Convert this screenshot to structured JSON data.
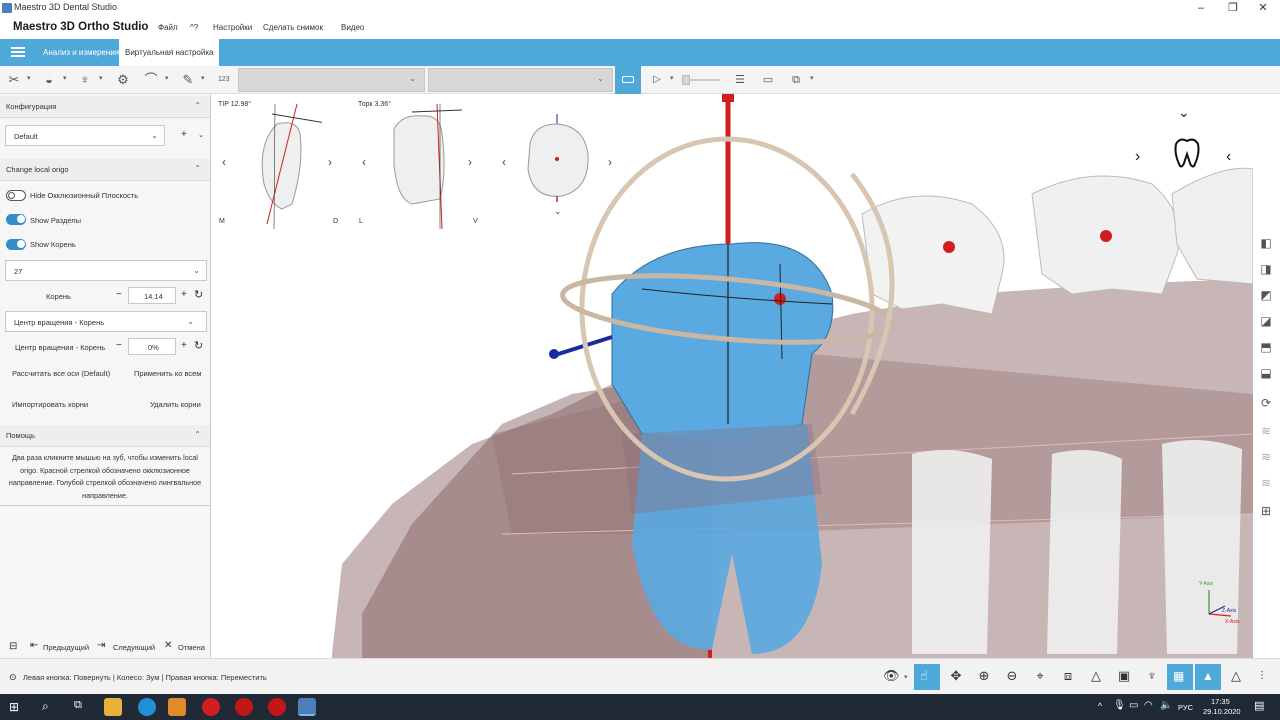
{
  "window": {
    "title": "Maestro 3D Dental Studio",
    "min": "–",
    "max": "❐",
    "close": "✕"
  },
  "menubar": {
    "brand": "Maestro 3D Ortho Studio",
    "items": [
      "Файл",
      "^?",
      "Настройки",
      "Сделать снимок",
      "Видео"
    ]
  },
  "ribbon": {
    "tabs": [
      "Анализ и измерения",
      "Виртуальная настройка"
    ],
    "active_tab": 1
  },
  "toolbar": {
    "label_123": "123",
    "combo1": "",
    "combo2": ""
  },
  "leftpanel": {
    "config_header": "Конфигурация",
    "config_value": "Default",
    "config_add": "+",
    "change_header": "Change local origo",
    "toggle_occlusal": {
      "label": "Hide Окклюзионный Плоскость",
      "on": false
    },
    "toggle_sections": {
      "label": "Show Разделы",
      "on": true
    },
    "toggle_roots": {
      "label": "Show Корень",
      "on": true
    },
    "tooth_select": "27",
    "root_label": "Корень",
    "root_value": "14.14",
    "rotation_center_select": "Центр вращения - Корень",
    "rotation_center_label": "Центр вращения - Корень",
    "rotation_center_value": "0%",
    "minus": "−",
    "plus": "+",
    "recalc_axes": "Рассчитать все оси (Default)",
    "apply_all": "Применить ко всем",
    "import_roots": "Импортировать корни",
    "delete_roots": "Удалить корни",
    "help_header": "Помощь",
    "help_text": "Два раза кликните мышью на зуб, чтобы изменить local origo. Красной стрелкой обозначено окклюзионное направление. Голубой стрелкой обозначено лингвальное направление.",
    "nav_prev": "Предыдущий",
    "nav_next": "Следующий",
    "nav_cancel": "Отмена"
  },
  "viewport": {
    "tip_label": "TIP 12.98°",
    "torque_label": "Торк 3.36°",
    "label_m": "M",
    "label_d": "D",
    "label_l": "L",
    "label_v": "V",
    "axis_y": "Y-Axis",
    "axis_x": "X-Axis",
    "axis_z": "Z-Axis"
  },
  "statusbar": {
    "hint": "Левая кнопка: Повернуть | Колесо: Зум | Правая кнопка: Переместить"
  },
  "taskbar": {
    "lang": "РУС",
    "time": "17:35",
    "date": "29.10.2020"
  },
  "colors": {
    "ribbon": "#4ea8d8",
    "tooth_selected": "#5aa9e0",
    "gingiva": "#8a6a6a",
    "ring": "#d8c6b2",
    "axis_red": "#d21e1e",
    "axis_blue": "#1a2aa0"
  }
}
